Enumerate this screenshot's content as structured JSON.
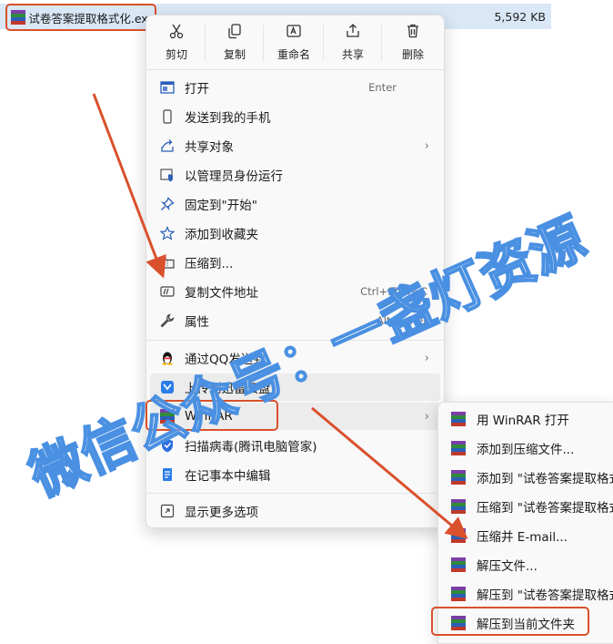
{
  "file": {
    "name": "试卷答案提取格式化.exe",
    "size": "5,592 KB"
  },
  "toolbar": [
    {
      "label": "剪切",
      "icon": "cut-icon"
    },
    {
      "label": "复制",
      "icon": "copy-icon"
    },
    {
      "label": "重命名",
      "icon": "rename-icon"
    },
    {
      "label": "共享",
      "icon": "share-icon"
    },
    {
      "label": "删除",
      "icon": "delete-icon"
    }
  ],
  "menu": {
    "open": {
      "label": "打开",
      "shortcut": "Enter"
    },
    "send_phone": {
      "label": "发送到我的手机"
    },
    "share_obj": {
      "label": "共享对象"
    },
    "run_admin": {
      "label": "以管理员身份运行"
    },
    "pin_start": {
      "label": "固定到\"开始\""
    },
    "add_fav": {
      "label": "添加到收藏夹"
    },
    "compress": {
      "label": "压缩到..."
    },
    "copy_path": {
      "label": "复制文件地址",
      "shortcut": "Ctrl+Shift+C"
    },
    "properties": {
      "label": "属性",
      "shortcut": "Alt+Enter"
    },
    "send_qq": {
      "label": "通过QQ发送到"
    },
    "upload_xunlei": {
      "label": "上传到迅雷云盘"
    },
    "winrar": {
      "label": "WinRAR"
    },
    "scan": {
      "label": "扫描病毒(腾讯电脑管家)"
    },
    "notepad": {
      "label": "在记事本中编辑"
    },
    "more": {
      "label": "显示更多选项"
    }
  },
  "submenu": [
    {
      "label": "用 WinRAR 打开"
    },
    {
      "label": "添加到压缩文件..."
    },
    {
      "label": "添加到 \"试卷答案提取格式"
    },
    {
      "label": "压缩到 \"试卷答案提取格式"
    },
    {
      "label": "压缩并 E-mail..."
    },
    {
      "label": "解压文件..."
    },
    {
      "label": "解压到 \"试卷答案提取格式"
    },
    {
      "label": "解压到当前文件夹"
    }
  ],
  "watermark": "微信公众号：一盏灯资源",
  "colors": {
    "highlight": "#d9512c",
    "menu_bg": "#f9f9f9",
    "selection": "#d9e7f6"
  }
}
